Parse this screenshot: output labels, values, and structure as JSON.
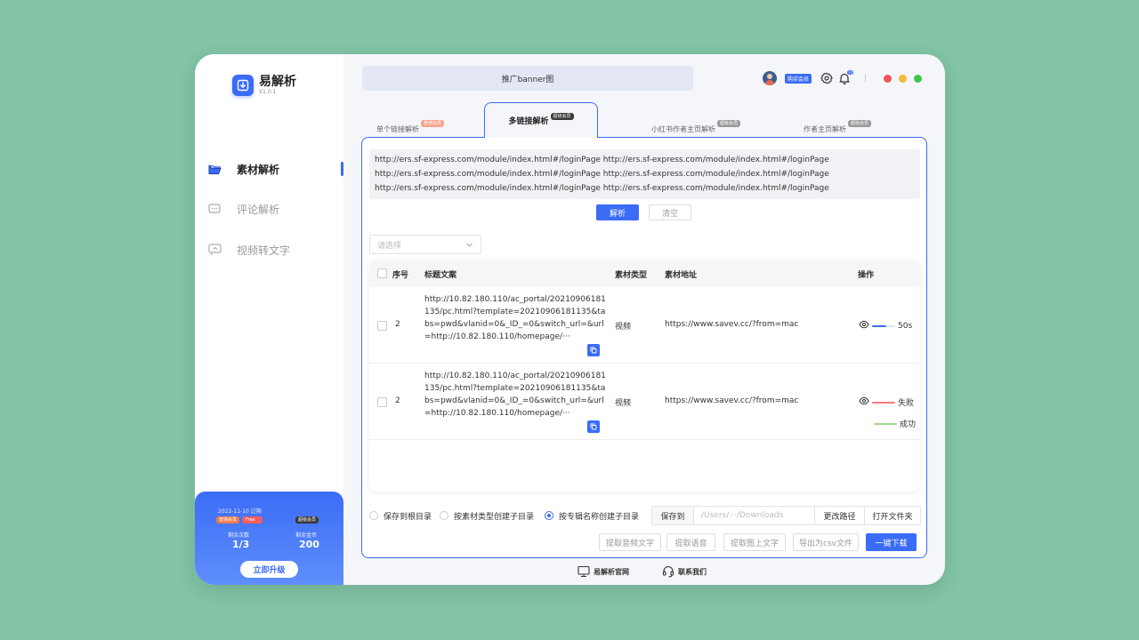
{
  "app": {
    "name": "易解析",
    "version": "V1.0.1"
  },
  "sidebar": {
    "items": [
      {
        "label": "素材解析",
        "icon": "folder-open-icon",
        "active": true
      },
      {
        "label": "评论解析",
        "icon": "comment-icon",
        "active": false
      },
      {
        "label": "视频转文字",
        "icon": "video-text-icon",
        "active": false
      }
    ]
  },
  "vip_card": {
    "expire": "2022-11-10 过期",
    "badge_normal": "普通会员",
    "badge_free": "Free",
    "badge_super": "超级会员",
    "remaining_times_label": "剩余次数",
    "remaining_times_value": "1/3",
    "remaining_coins_label": "剩余金币",
    "remaining_coins_value": "200",
    "upgrade_label": "立即升级"
  },
  "header": {
    "banner": "推广banner图",
    "buy_vip": "购买会员",
    "notif_count": "10"
  },
  "tabs": [
    {
      "label": "单个链接解析",
      "badge": "普通会员"
    },
    {
      "label": "多链接解析",
      "badge": "超级会员",
      "active": true
    },
    {
      "label": "小红书作者主页解析",
      "badge": "超级会员"
    },
    {
      "label": "作者主页解析",
      "badge": "超级会员"
    }
  ],
  "url_input": {
    "lines": [
      "http://ers.sf-express.com/module/index.html#/loginPage http://ers.sf-express.com/module/index.html#/loginPage",
      "http://ers.sf-express.com/module/index.html#/loginPage http://ers.sf-express.com/module/index.html#/loginPage",
      "http://ers.sf-express.com/module/index.html#/loginPage http://ers.sf-express.com/module/index.html#/loginPage"
    ]
  },
  "buttons": {
    "parse": "解析",
    "clear": "清空"
  },
  "select": {
    "placeholder": "请选择"
  },
  "table": {
    "headers": [
      "序号",
      "标题文案",
      "素材类型",
      "素材地址",
      "操作"
    ],
    "rows": [
      {
        "index": "2",
        "title": "http://10.82.180.110/ac_portal/20210906181135/pc.html?template=20210906181135&tabs=pwd&vlanid=0&_ID_=0&switch_url=&url=http://10.82.180.110/homepage/···",
        "type": "视频",
        "address": "https://www.savev.cc/?from=mac",
        "status": [
          {
            "text": "50s",
            "color": "#3b6cf6",
            "progress": 0.6
          }
        ]
      },
      {
        "index": "2",
        "title": "http://10.82.180.110/ac_portal/20210906181135/pc.html?template=20210906181135&tabs=pwd&vlanid=0&_ID_=0&switch_url=&url=http://10.82.180.110/homepage/···",
        "type": "视频",
        "address": "https://www.savev.cc/?from=mac",
        "status": [
          {
            "text": "失败",
            "color": "#f47c7c",
            "progress": 1
          },
          {
            "text": "成功",
            "color": "#9fd98a",
            "progress": 1
          }
        ]
      }
    ]
  },
  "save_options": {
    "options": [
      "保存到根目录",
      "按素材类型创建子目录",
      "按专辑名称创建子目录"
    ],
    "selected_index": 2,
    "save_to_label": "保存到",
    "path_placeholder": "/Users/···/Downloads",
    "change_path": "更改路径",
    "open_folder": "打开文件夹"
  },
  "actions": [
    "提取音频文字",
    "提取语音",
    "提取图上文字",
    "导出为csv文件",
    "一键下载"
  ],
  "footer": {
    "website": "易解析官网",
    "contact": "联系我们"
  },
  "colors": {
    "accent": "#3b6cf6",
    "background": "#82c4a5",
    "close": "#f25656",
    "minimize": "#f5b93a",
    "maximize": "#3cc94a"
  }
}
